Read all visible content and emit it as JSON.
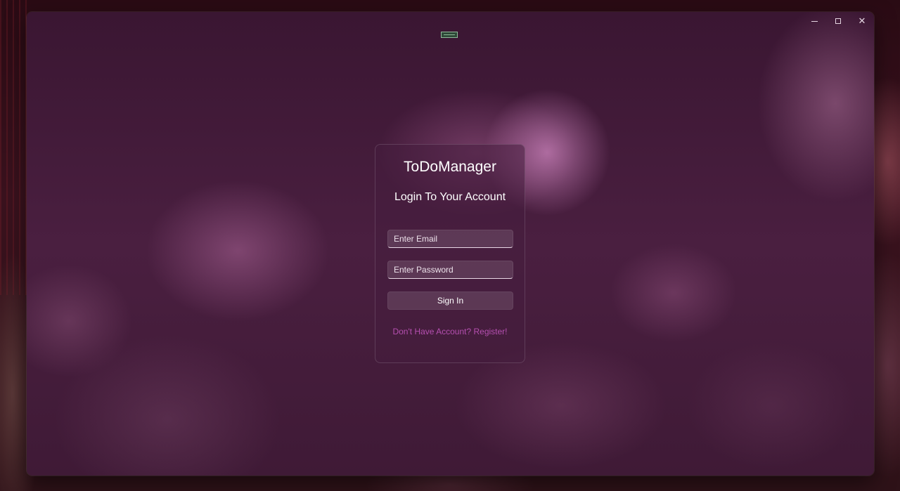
{
  "window": {
    "caption_buttons": {
      "minimize_icon": "minimize-icon",
      "maximize_icon": "maximize-icon",
      "close_icon": "close-icon",
      "close_glyph": "✕"
    }
  },
  "login_card": {
    "app_title": "ToDoManager",
    "heading": "Login To Your Account",
    "email_placeholder": "Enter Email",
    "email_value": "",
    "password_placeholder": "Enter Password",
    "password_value": "",
    "sign_in_label": "Sign In",
    "register_link": "Don't Have Account? Register!"
  },
  "colors": {
    "accent_link": "#b54fb0",
    "window_tint": "#4a1f40",
    "text": "#ffffff"
  }
}
